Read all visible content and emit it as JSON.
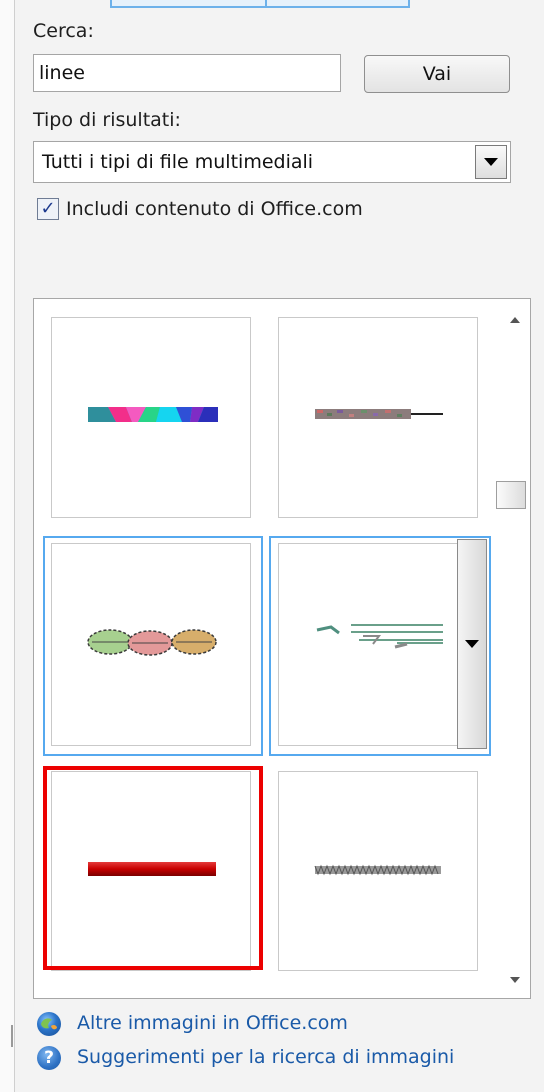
{
  "search": {
    "label": "Cerca:",
    "value": "linee",
    "go_label": "Vai"
  },
  "results_type": {
    "label": "Tipo di risultati:",
    "selected": "Tutti i tipi di file multimediali"
  },
  "include_office": {
    "label": "Includi contenuto di Office.com",
    "checked": true
  },
  "gallery": {
    "items": [
      {
        "name": "colorful-line-clipart",
        "state": "normal"
      },
      {
        "name": "speckled-line-clipart",
        "state": "normal"
      },
      {
        "name": "leaves-line-clipart",
        "state": "hover"
      },
      {
        "name": "green-lines-clipart",
        "state": "hover-dropdown"
      },
      {
        "name": "red-line-clipart",
        "state": "selected"
      },
      {
        "name": "gray-zigzag-line-clipart",
        "state": "normal"
      }
    ]
  },
  "links": {
    "more_images": "Altre immagini in Office.com",
    "search_tips": "Suggerimenti per la ricerca di immagini"
  },
  "colors": {
    "accent_blue": "#56a9ef",
    "selection_red": "#ec0000",
    "link_blue": "#1a5aa8"
  }
}
